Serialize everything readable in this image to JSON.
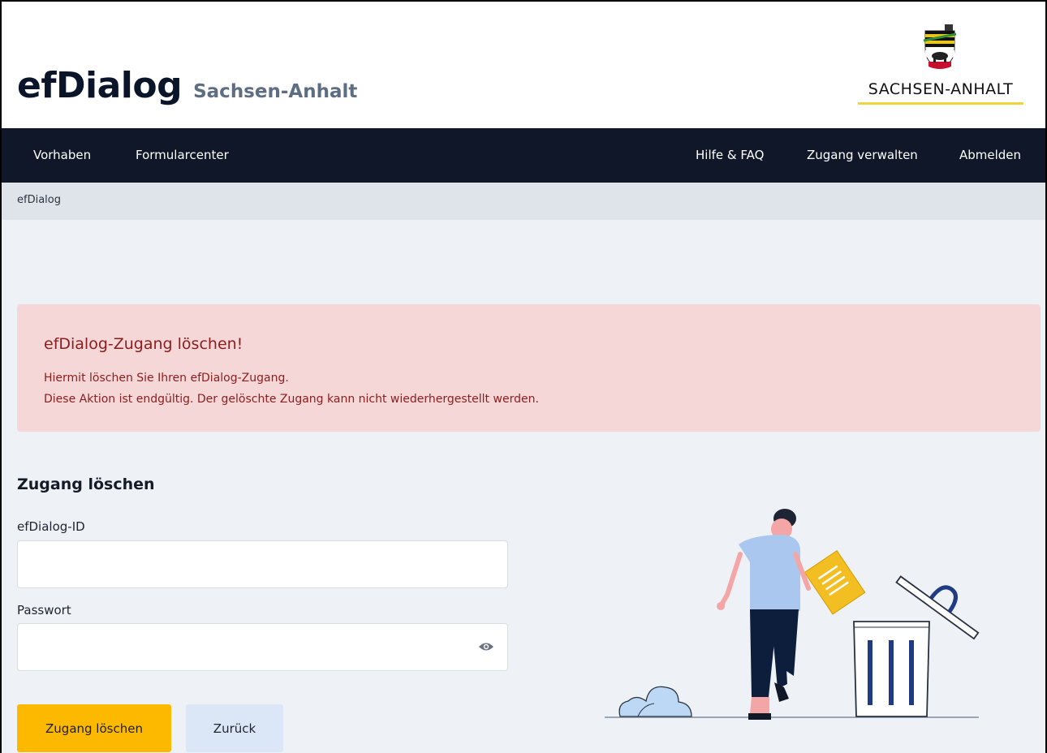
{
  "header": {
    "brand_name": "efDialog",
    "brand_sub": "Sachsen-Anhalt",
    "state_logo_text": "SACHSEN-ANHALT"
  },
  "nav": {
    "left": [
      "Vorhaben",
      "Formularcenter"
    ],
    "right": [
      "Hilfe & FAQ",
      "Zugang verwalten",
      "Abmelden"
    ]
  },
  "breadcrumb": {
    "current": "efDialog"
  },
  "alert": {
    "title": "efDialog-Zugang löschen!",
    "line1": "Hiermit löschen Sie Ihren efDialog-Zugang.",
    "line2": "Diese Aktion ist endgültig. Der gelöschte Zugang kann nicht wiederhergestellt werden."
  },
  "form": {
    "title": "Zugang löschen",
    "id_label": "efDialog-ID",
    "id_value": "",
    "password_label": "Passwort",
    "password_value": "",
    "submit_label": "Zugang löschen",
    "back_label": "Zurück"
  },
  "colors": {
    "nav_bg": "#0f1729",
    "alert_bg": "#f6d7d8",
    "alert_text": "#8a1d1d",
    "primary_button": "#fcb900",
    "secondary_button": "#dbe7f6",
    "content_bg": "#eef1f6"
  }
}
